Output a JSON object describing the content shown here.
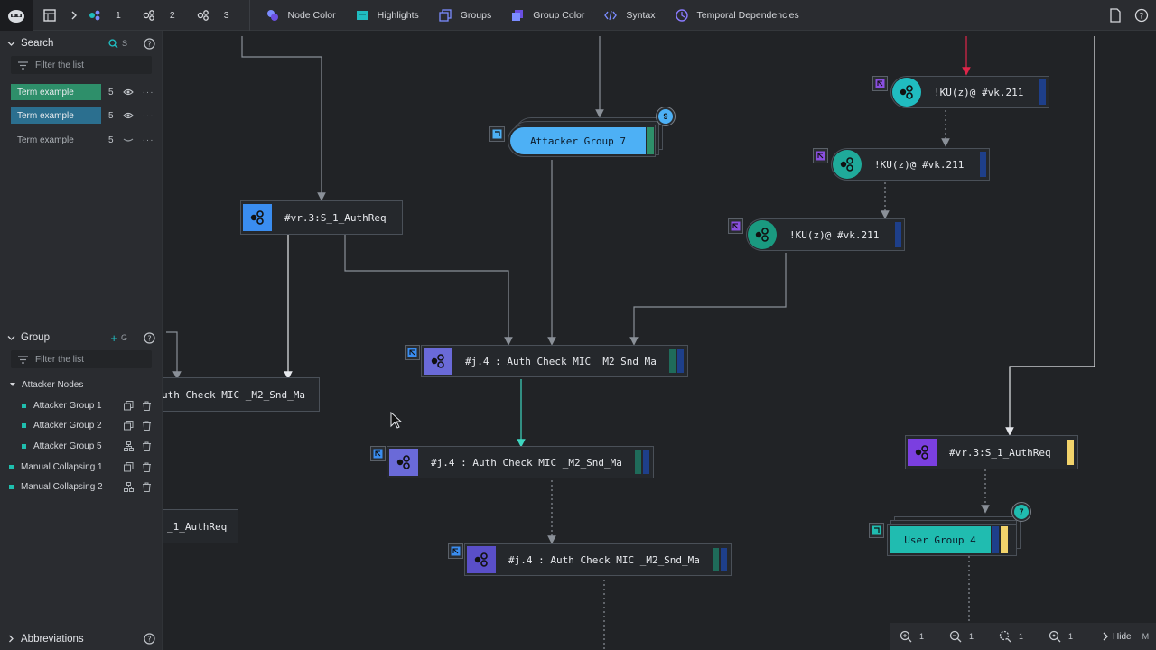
{
  "toolbar": {
    "levels": [
      {
        "label": "1",
        "icon": "level-1-icon"
      },
      {
        "label": "2",
        "icon": "level-2-icon"
      },
      {
        "label": "3",
        "icon": "level-3-icon"
      }
    ],
    "items": [
      {
        "id": "node-color",
        "label": "Node Color",
        "color": "#7b8cff"
      },
      {
        "id": "highlights",
        "label": "Highlights",
        "color": "#20bcc0"
      },
      {
        "id": "groups",
        "label": "Groups",
        "color": "#7b8cff"
      },
      {
        "id": "group-color",
        "label": "Group Color",
        "color": "#7b8cff"
      },
      {
        "id": "syntax",
        "label": "Syntax",
        "color": "#7b8cff"
      },
      {
        "id": "temporal",
        "label": "Temporal Dependencies",
        "color": "#8a7bff"
      }
    ]
  },
  "sidebar": {
    "search": {
      "title": "Search",
      "shortcut": "S",
      "filter_placeholder": "Filter the list",
      "terms": [
        {
          "label": "Term example",
          "count": "5",
          "color": "#2e8f6a",
          "visible": true
        },
        {
          "label": "Term example",
          "count": "5",
          "color": "#2b6f8f",
          "visible": true
        },
        {
          "label": "Term example",
          "count": "5",
          "color": "",
          "visible": false
        }
      ]
    },
    "group": {
      "title": "Group",
      "shortcut": "G",
      "filter_placeholder": "Filter the list",
      "parent": "Attacker Nodes",
      "children": [
        "Attacker Group 1",
        "Attacker Group 2",
        "Attacker Group 5"
      ],
      "collapsings": [
        "Manual Collapsing 1",
        "Manual Collapsing 2"
      ]
    },
    "abbreviations": {
      "title": "Abbreviations"
    }
  },
  "graph": {
    "nodes": {
      "vr3_top": "#vr.3:S_1_AuthReq",
      "attacker_group": "Attacker Group 7",
      "attacker_group_count": "9",
      "ku1": "!KU(z)@ #vk.211",
      "ku2": "!KU(z)@ #vk.211",
      "ku3": "!KU(z)@ #vk.211",
      "auth1": "#j.4 : Auth Check MIC _M2_Snd_Ma",
      "auth_left": "uth Check MIC _M2_Snd_Ma",
      "auth2": "#j.4 : Auth Check MIC _M2_Snd_Ma",
      "auth3": "#j.4 : Auth Check MIC _M2_Snd_Ma",
      "authreq_left": "_1_AuthReq",
      "vr3_right": "#vr.3:S_1_AuthReq",
      "user_group": "User Group 4",
      "user_group_count": "7"
    }
  },
  "zoombar": {
    "values": [
      "1",
      "1",
      "1",
      "1"
    ],
    "hide_label": "Hide",
    "hide_shortcut": "M"
  }
}
